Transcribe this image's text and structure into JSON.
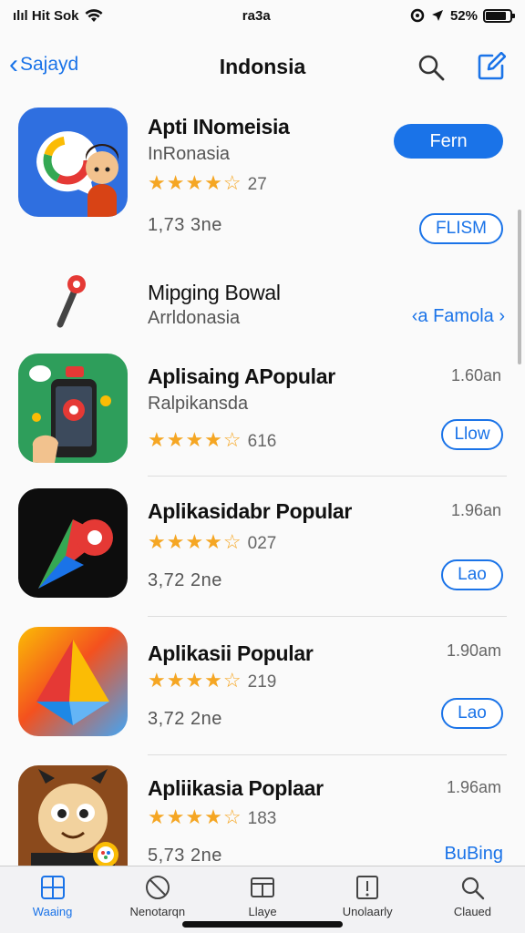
{
  "status": {
    "carrier": "ılıl Hit Sok",
    "time": "ra3a",
    "battery_pct": "52%",
    "battery_level": 0.8
  },
  "nav": {
    "back_label": "Sajayd",
    "title": "Indonsia",
    "search_icon": "search-icon",
    "edit_icon": "compose-icon"
  },
  "apps": [
    {
      "name": "Apti INomeisia",
      "subtitle": "InRonasia",
      "stars": "★★★★☆",
      "rating": "27",
      "meta": "1,73 3ne",
      "primary_button": "Fern",
      "secondary_button": "FLISM"
    },
    {
      "name": "Mipging Bowal",
      "subtitle": "Arrldonasia",
      "link": "‹a Famola ›"
    },
    {
      "name": "Aplisaing APopular",
      "subtitle": "Ralpikansda",
      "stars": "★★★★☆",
      "rating": "616",
      "time": "1.60an",
      "button": "Llow"
    },
    {
      "name": "Aplikasidabr Popular",
      "stars": "★★★★☆",
      "rating": "027",
      "meta": "3,72 2ne",
      "time": "1.96an",
      "button": "Lao"
    },
    {
      "name": "Aplikasii Popular",
      "stars": "★★★★☆",
      "rating": "219",
      "meta": "3,72 2ne",
      "time": "1.90am",
      "button": "Lao"
    },
    {
      "name": "Apliikasia Poplaar",
      "stars": "★★★★☆",
      "rating": "183",
      "meta": "5,73 2ne",
      "time": "1.96am",
      "button": "BuBing"
    }
  ],
  "tabs": [
    {
      "label": "Waaing",
      "icon": "today-icon",
      "active": true
    },
    {
      "label": "Nenotarqn",
      "icon": "games-icon",
      "active": false
    },
    {
      "label": "Llaye",
      "icon": "apps-icon",
      "active": false
    },
    {
      "label": "Unolaarly",
      "icon": "updates-icon",
      "active": false
    },
    {
      "label": "Claued",
      "icon": "search-icon",
      "active": false
    }
  ],
  "colors": {
    "accent": "#1a73e8",
    "star": "#f5a623"
  }
}
